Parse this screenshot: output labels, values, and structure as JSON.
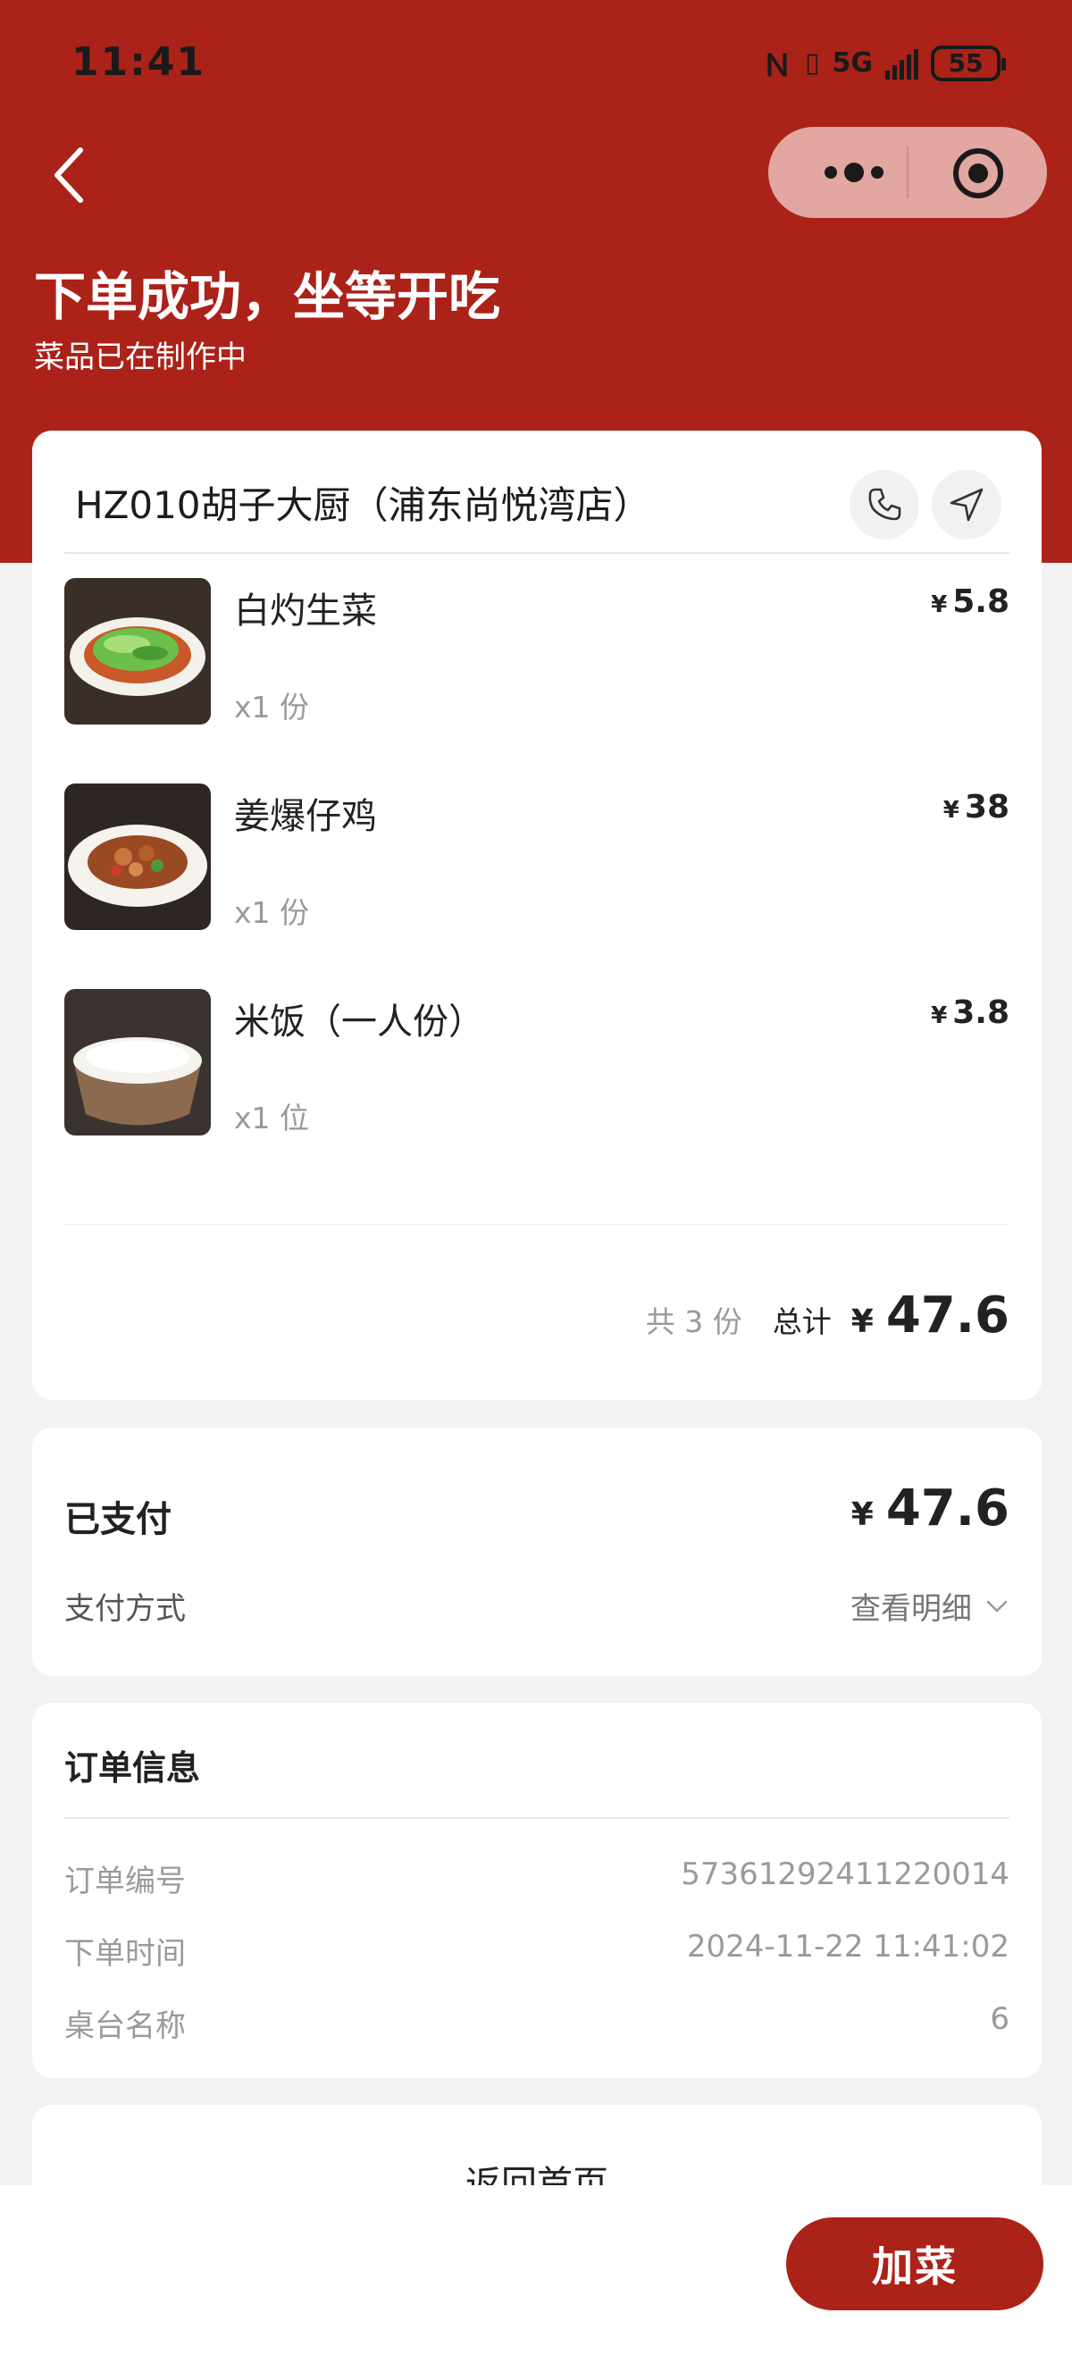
{
  "status_bar": {
    "time": "11:41",
    "network": "5G",
    "battery": "55"
  },
  "header": {
    "title": "下单成功，坐等开吃",
    "subtitle": "菜品已在制作中"
  },
  "store": {
    "name": "HZ010胡子大厨（浦东尚悦湾店）"
  },
  "dishes": [
    {
      "name": "白灼生菜",
      "qty": "x1 份",
      "price": "5.8",
      "currency": "¥"
    },
    {
      "name": "姜爆仔鸡",
      "qty": "x1 份",
      "price": "38",
      "currency": "¥"
    },
    {
      "name": "米饭（一人份）",
      "qty": "x1 位",
      "price": "3.8",
      "currency": "¥"
    }
  ],
  "summary": {
    "count": "共 3 份",
    "total_label": "总计",
    "currency": "¥",
    "total": "47.6"
  },
  "payment": {
    "paid_label": "已支付",
    "currency": "¥",
    "amount": "47.6",
    "method_label": "支付方式",
    "detail_label": "查看明细"
  },
  "order_info": {
    "title": "订单信息",
    "rows": [
      {
        "key": "订单编号",
        "value": "57361292411220014"
      },
      {
        "key": "下单时间",
        "value": "2024-11-22 11:41:02"
      },
      {
        "key": "桌台名称",
        "value": "6"
      }
    ]
  },
  "actions": {
    "home_label": "返回首页",
    "add_label": "加菜"
  },
  "colors": {
    "brand_red": "#ab2219",
    "page_bg": "#f2f2f2",
    "capsule_bg": "#e3a7a2"
  }
}
